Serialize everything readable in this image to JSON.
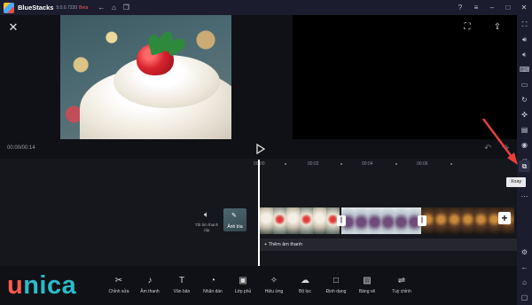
{
  "titlebar": {
    "app_name": "BlueStacks",
    "version": "5.0.0.7220",
    "badge": "Beta",
    "left_icons": [
      "back-icon",
      "home-icon",
      "multi-instance-icon"
    ],
    "right_icons": [
      "help-icon",
      "menu-icon",
      "minimize-icon",
      "maximize-icon",
      "close-icon"
    ]
  },
  "sidebar": {
    "icons": [
      "fullscreen-icon",
      "volume-up-icon",
      "volume-down-icon",
      "keyboard-icon",
      "screenshot-icon",
      "rotate-icon",
      "gamepad-icon",
      "media-icon",
      "camera-icon",
      "folder-icon",
      "rotate-screen-icon",
      "more-icon",
      "eco-icon",
      "settings-icon",
      "back-icon",
      "home-icon",
      "recent-apps-icon"
    ],
    "tooltip": "Xoay"
  },
  "editor": {
    "timecode": "00:00/00:14",
    "ruler_ticks": [
      "00:00",
      "00:02",
      "00:04",
      "00:06"
    ],
    "mute_label": "Tắt âm thanh clip",
    "cover_label": "Ảnh bìa",
    "add_audio_label": "+ Thêm âm thanh"
  },
  "watermark": {
    "text_first": "u",
    "text_rest": "nica"
  },
  "toolbar": {
    "tools": [
      {
        "label": "Chỉnh sửa",
        "icon": "scissors-icon"
      },
      {
        "label": "Âm thanh",
        "icon": "music-icon"
      },
      {
        "label": "Văn bản",
        "icon": "text-icon"
      },
      {
        "label": "Nhãn dán",
        "icon": "sticker-icon"
      },
      {
        "label": "Lớp phủ",
        "icon": "overlay-icon"
      },
      {
        "label": "Hiệu ứng",
        "icon": "effects-icon"
      },
      {
        "label": "Bộ lọc",
        "icon": "filter-icon"
      },
      {
        "label": "Định dạng",
        "icon": "format-icon"
      },
      {
        "label": "Bảng vẽ",
        "icon": "canvas-icon"
      },
      {
        "label": "Tuỳ chỉnh",
        "icon": "adjust-icon"
      }
    ]
  },
  "colors": {
    "accent_arrow": "#e8413a",
    "unica_red": "#ff5a4f",
    "unica_teal": "#2abccb",
    "titlebar": "#1b1d2e"
  }
}
